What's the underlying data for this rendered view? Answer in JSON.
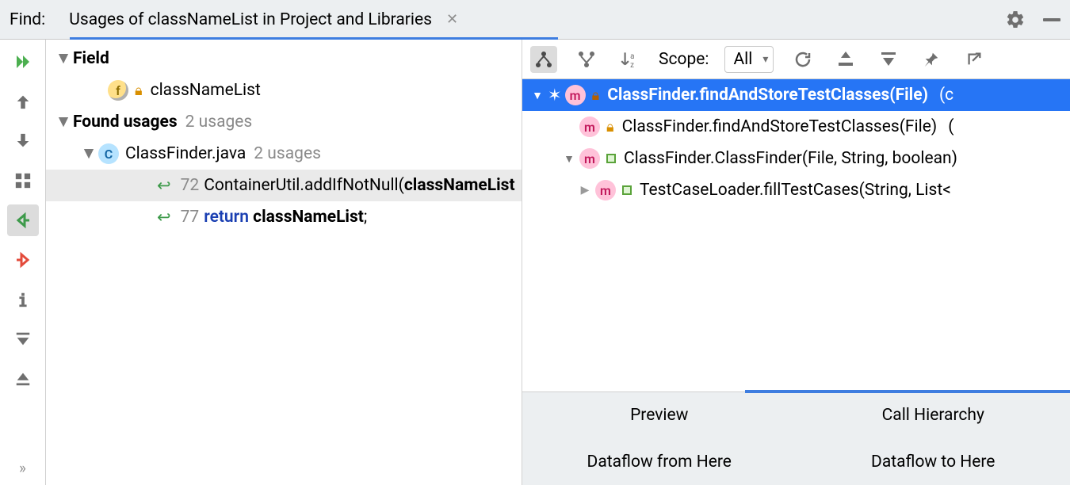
{
  "header": {
    "find_label": "Find:",
    "tab_title": "Usages of classNameList in Project and Libraries"
  },
  "tree": {
    "field_section": "Field",
    "field_name": "classNameList",
    "found_section": "Found usages",
    "found_count": "2 usages",
    "file_name": "ClassFinder.java",
    "file_count": "2 usages",
    "usage1": {
      "line": "72",
      "prefix": "ContainerUtil.addIfNotNull(",
      "highlight": "classNameList"
    },
    "usage2": {
      "line": "77",
      "keyword": "return",
      "highlight": "classNameList",
      "suffix": ";"
    }
  },
  "right_toolbar": {
    "scope_label": "Scope:",
    "scope_value": "All"
  },
  "hier": {
    "row1": {
      "name": "ClassFinder.findAndStoreTestClasses(File)",
      "pkg": "(c"
    },
    "row2": {
      "name": "ClassFinder.findAndStoreTestClasses(File)",
      "pkg": "("
    },
    "row3": {
      "name": "ClassFinder.ClassFinder(File, String, boolean)"
    },
    "row4": {
      "name": "TestCaseLoader.fillTestCases(String, List<"
    }
  },
  "bottom_tabs": {
    "preview": "Preview",
    "call_hierarchy": "Call Hierarchy",
    "dataflow_from": "Dataflow from Here",
    "dataflow_to": "Dataflow to Here"
  }
}
